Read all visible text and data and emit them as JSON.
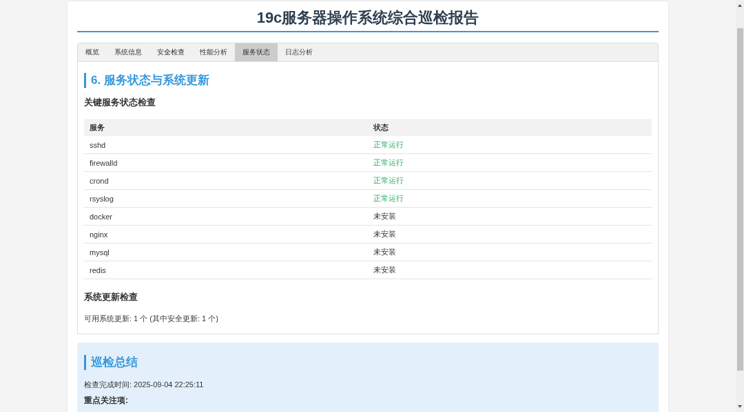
{
  "title": "19c服务器操作系统综合巡检报告",
  "tabs": [
    {
      "label": "概览",
      "selected": false
    },
    {
      "label": "系统信息",
      "selected": false
    },
    {
      "label": "安全检查",
      "selected": false
    },
    {
      "label": "性能分析",
      "selected": false
    },
    {
      "label": "服务状态",
      "selected": true
    },
    {
      "label": "日志分析",
      "selected": false
    }
  ],
  "section": {
    "heading": "6. 服务状态与系统更新",
    "services_heading": "关键服务状态检查",
    "table": {
      "columns": [
        "服务",
        "状态"
      ],
      "rows": [
        {
          "service": "sshd",
          "status": "正常运行",
          "kind": "running"
        },
        {
          "service": "firewalld",
          "status": "正常运行",
          "kind": "running"
        },
        {
          "service": "crond",
          "status": "正常运行",
          "kind": "running"
        },
        {
          "service": "rsyslog",
          "status": "正常运行",
          "kind": "running"
        },
        {
          "service": "docker",
          "status": "未安装",
          "kind": "absent"
        },
        {
          "service": "nginx",
          "status": "未安装",
          "kind": "absent"
        },
        {
          "service": "mysql",
          "status": "未安装",
          "kind": "absent"
        },
        {
          "service": "redis",
          "status": "未安装",
          "kind": "absent"
        }
      ]
    },
    "updates_heading": "系统更新检查",
    "updates_text": "可用系统更新: 1 个 (其中安全更新: 1 个)"
  },
  "summary": {
    "heading": "巡检总结",
    "completed": "检查完成时间: 2025-09-04 22:25:11",
    "focus_heading": "重点关注项:"
  }
}
